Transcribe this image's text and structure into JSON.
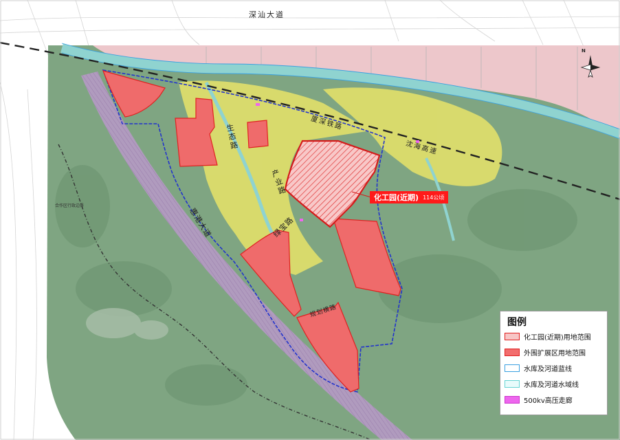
{
  "roads": {
    "shenshan_avenue": "深汕大道",
    "xiashen_railway": "厦深铁路",
    "shenhai_expressway": "沈海高速",
    "ecological_road": "生态路",
    "industrial_road": "产业路",
    "lvbao_road": "绿宝路",
    "huigang_avenue": "惠港大道",
    "planned_road": "规划横路",
    "cooperation_boundary": "合作区行政边界"
  },
  "callout": {
    "name": "化工园(近期)",
    "area": "114公顷"
  },
  "compass": {
    "letter": "N"
  },
  "legend": {
    "title": "图例",
    "items": [
      {
        "label": "化工园(近期)用地范围",
        "fill": "#f7c6c6",
        "stroke": "#e02020"
      },
      {
        "label": "外围扩展区用地范围",
        "fill": "#f26d6d",
        "stroke": "#e02020"
      },
      {
        "label": "水库及河道蓝线",
        "fill": "#ffffff",
        "stroke": "#3aa0e0"
      },
      {
        "label": "水库及河道水域线",
        "fill": "#e8fbfb",
        "stroke": "#66d4d4"
      },
      {
        "label": "500kv高压走廊",
        "fill": "#ee66ee",
        "stroke": "#cc33cc"
      }
    ]
  },
  "colors": {
    "forest": "#7fa582",
    "urban_pink": "#f3c8cf",
    "yellow_zone": "#e2e06a",
    "water": "#8fd3d0",
    "parcel_red": "#ef6b6b",
    "boundary_blue": "#2233cc"
  }
}
